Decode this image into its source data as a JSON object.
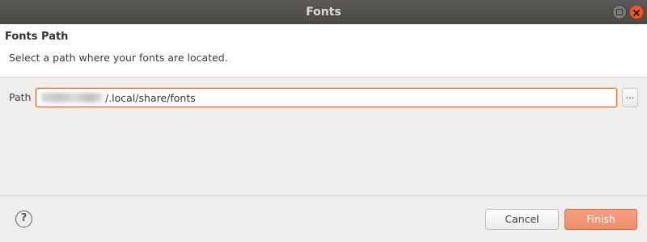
{
  "window": {
    "title": "Fonts"
  },
  "header": {
    "heading": "Fonts Path",
    "description": "Select a path where your fonts are located."
  },
  "path": {
    "label": "Path",
    "value_suffix": "/.local/share/fonts",
    "browse_label": "..."
  },
  "footer": {
    "help_glyph": "?",
    "cancel_label": "Cancel",
    "finish_label": "Finish"
  },
  "colors": {
    "accent": "#e9662a",
    "finish_button": "#f2977a",
    "titlebar": "#52514d"
  }
}
